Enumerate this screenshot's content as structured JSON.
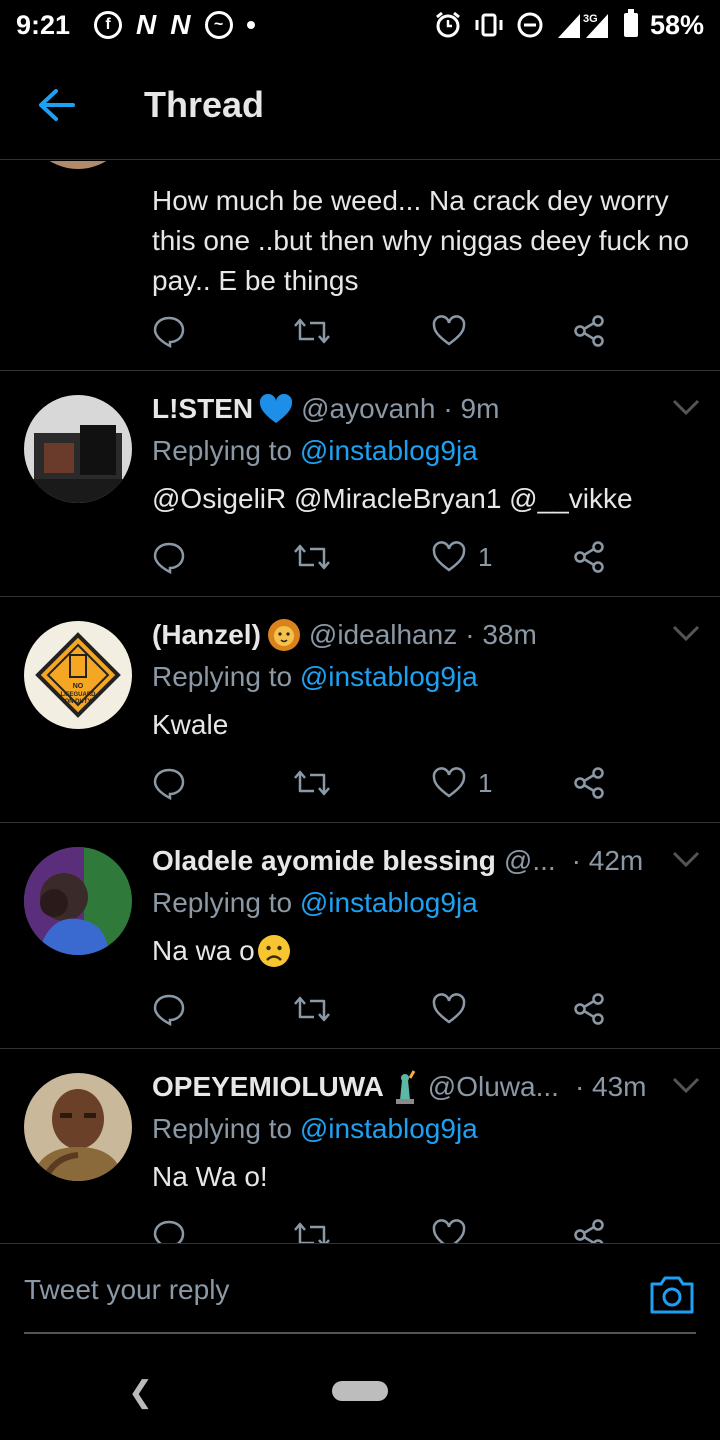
{
  "status_bar": {
    "time": "9:21",
    "network": "3G",
    "battery": "58%"
  },
  "header": {
    "title": "Thread"
  },
  "tweets": [
    {
      "text": "How much be weed... Na crack dey worry this one ..but then why niggas deey fuck no pay.. E be things",
      "reply_count": "",
      "retweet_count": "",
      "like_count": ""
    },
    {
      "name": "L!STEN",
      "handle": "@ayovanh",
      "time": "· 9m",
      "replying_label": "Replying to",
      "replying_to": "@instablog9ja",
      "text_mentions": "@OsigeliR @MiracleBryan1 @__vikke",
      "like_count": "1"
    },
    {
      "name": "(Hanzel)",
      "handle": "@idealhanz",
      "time": "· 38m",
      "replying_label": "Replying to",
      "replying_to": "@instablog9ja",
      "text": "Kwale",
      "like_count": "1"
    },
    {
      "name": "Oladele ayomide blessing",
      "handle": "@...",
      "time": "· 42m",
      "replying_label": "Replying to",
      "replying_to": "@instablog9ja",
      "text": "Na wa o",
      "like_count": ""
    },
    {
      "name": "OPEYEMIOLUWA",
      "handle": "@Oluwa...",
      "time": "· 43m",
      "replying_label": "Replying to",
      "replying_to": "@instablog9ja",
      "text": "Na Wa o!",
      "like_count": ""
    }
  ],
  "reply_bar": {
    "placeholder": "Tweet your reply"
  },
  "colors": {
    "accent": "#1da1f2",
    "background": "#000000",
    "muted": "#8b98a5",
    "divider": "#2f3336"
  },
  "icons": [
    "back-arrow-icon",
    "reply-icon",
    "retweet-icon",
    "like-icon",
    "share-icon",
    "chevron-down-icon",
    "camera-icon",
    "blue-heart-icon",
    "lion-icon",
    "frown-icon",
    "liberty-icon"
  ]
}
